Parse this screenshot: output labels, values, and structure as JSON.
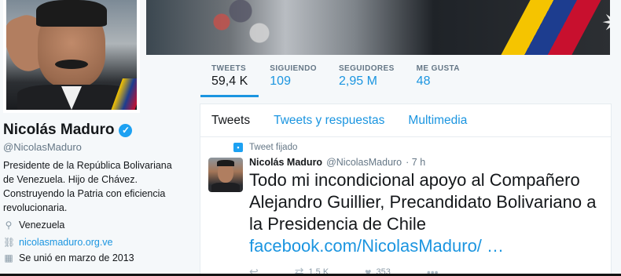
{
  "profile": {
    "name": "Nicolás Maduro",
    "verified_glyph": "✓",
    "handle": "@NicolasMaduro",
    "bio": "Presidente de la República Bolivariana de Venezuela. Hijo de Chávez. Construyendo la Patria con eficiencia revolucionaria.",
    "location": "Venezuela",
    "website": "nicolasmaduro.org.ve",
    "joined": "Se unió en marzo de 2013"
  },
  "stats": [
    {
      "label": "TWEETS",
      "value": "59,4 K"
    },
    {
      "label": "SIGUIENDO",
      "value": "109"
    },
    {
      "label": "SEGUIDORES",
      "value": "2,95 M"
    },
    {
      "label": "ME GUSTA",
      "value": "48"
    }
  ],
  "tabs": [
    "Tweets",
    "Tweets y respuestas",
    "Multimedia"
  ],
  "tweet": {
    "pinned_label": "Tweet fijado",
    "author": "Nicolás Maduro",
    "handle": "@NicolasMaduro",
    "time": "· 7 h",
    "text": "Todo mi incondicional apoyo al Compañero Alejandro Guillier, Precandidato Bolivariano a la Presidencia de Chile ",
    "link": "facebook.com/NicolasMaduro/ …",
    "retweets": "1,5 K",
    "likes": "353"
  },
  "icons": {
    "location": "map-pin-icon",
    "website": "link-icon",
    "joined": "calendar-icon",
    "pinned": "pin-icon",
    "reply": "reply-icon",
    "retweet": "retweet-icon",
    "like": "heart-icon"
  },
  "colors": {
    "accent": "#1b95e0",
    "verified": "#1da1f2",
    "muted": "#657786"
  }
}
